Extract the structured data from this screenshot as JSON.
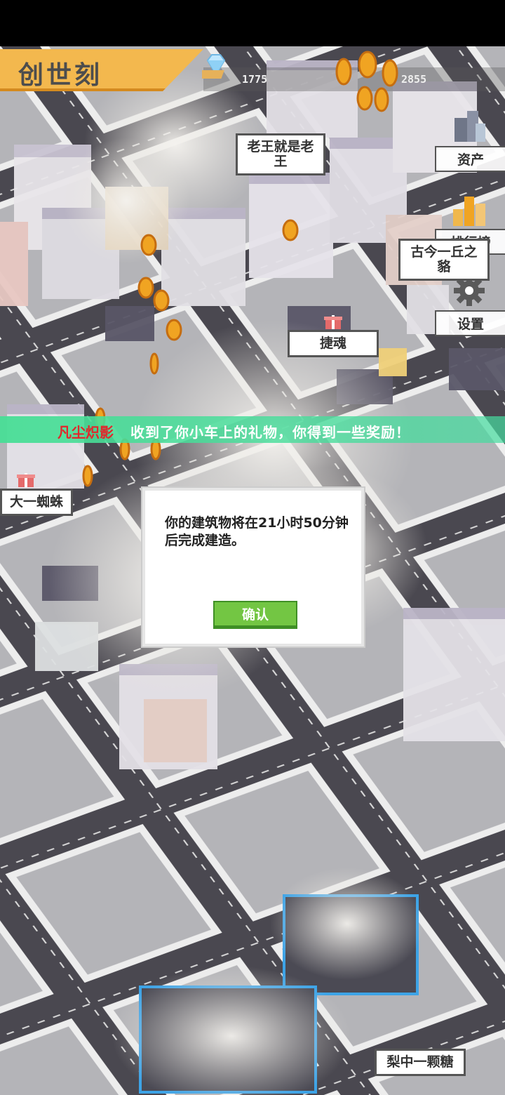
{
  "game": {
    "title": "创世刻",
    "resources": {
      "diamonds": "1775",
      "coins": "2855"
    },
    "diamond_icon": "diamond-icon",
    "coin_icon": "coin-stack-icon"
  },
  "side_menu": [
    {
      "label": "资产",
      "icon": "assets-icon"
    },
    {
      "label": "排行榜",
      "icon": "leaderboard-icon"
    },
    {
      "label": "设置",
      "icon": "gear-icon"
    }
  ],
  "map_labels": [
    {
      "text": "老王就是老王"
    },
    {
      "text": "古今一丘之貉"
    },
    {
      "text": "捷魂"
    },
    {
      "text": "大一蜘蛛"
    },
    {
      "text": "梨中一颗糖"
    }
  ],
  "banner": {
    "player": "凡尘炽影",
    "message": "收到了你小车上的礼物，你得到一些奖励！"
  },
  "dialog": {
    "message": "你的建筑物将在21小时50分钟后完成建造。",
    "confirm_label": "确认"
  },
  "colors": {
    "accent": "#f3b84e",
    "confirm": "#73c643",
    "banner": "#48de96",
    "banner_name": "#e3262b"
  }
}
